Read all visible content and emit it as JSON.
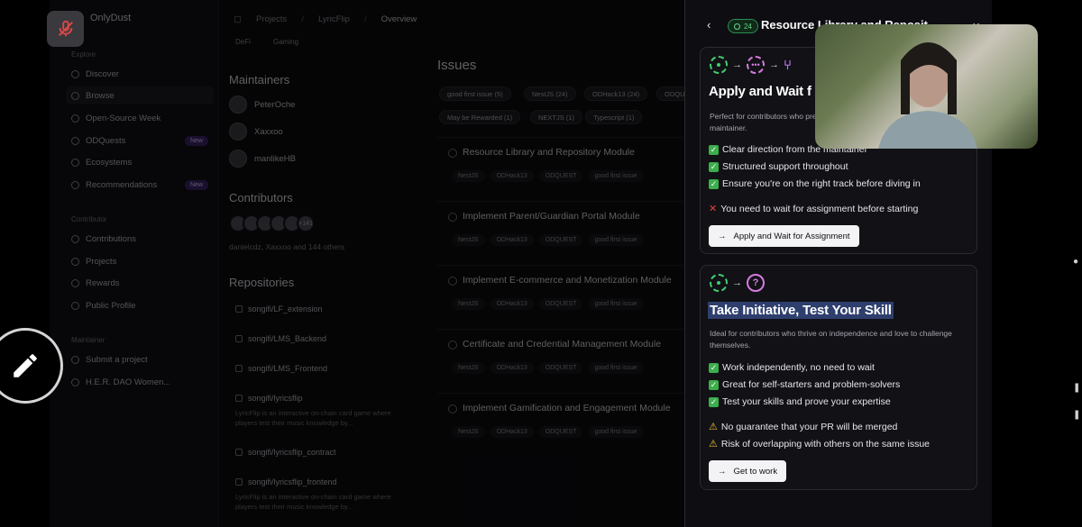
{
  "app": {
    "brand": "OnlyDust",
    "breadcrumbs": [
      "Projects",
      "LyricFlip",
      "Overview"
    ],
    "sidebar": {
      "explore_label": "Explore",
      "explore_items": [
        {
          "label": "Discover",
          "badge": ""
        },
        {
          "label": "Browse",
          "badge": ""
        },
        {
          "label": "Open-Source Week",
          "badge": ""
        },
        {
          "label": "ODQuests",
          "badge": "New"
        },
        {
          "label": "Ecosystems",
          "badge": ""
        },
        {
          "label": "Recommendations",
          "badge": "New"
        }
      ],
      "contributor_label": "Contributor",
      "contributor_items": [
        "Contributions",
        "Projects",
        "Rewards",
        "Public Profile"
      ],
      "maintainer_label": "Maintainer",
      "maintainer_items": [
        "Submit a project",
        "H.E.R. DAO Women..."
      ]
    },
    "categories": [
      "DeFi",
      "Gaming"
    ],
    "maintainers_title": "Maintainers",
    "maintainers": [
      "PeterOche",
      "Xaxxoo",
      "manlikeHB"
    ],
    "contributors_title": "Contributors",
    "contributors_more": "+141",
    "contributors_text": "danielcdz, Xaxxoo and 144 others",
    "repositories_title": "Repositories",
    "repositories": [
      {
        "name": "songifi/LF_extension",
        "desc": ""
      },
      {
        "name": "songifi/LMS_Backend",
        "desc": ""
      },
      {
        "name": "songifi/LMS_Frontend",
        "desc": ""
      },
      {
        "name": "songifi/lyricsflip",
        "desc": "LyricFlip is an interactive on-chain card game where players test their music knowledge by..."
      },
      {
        "name": "songifi/lyricsflip_contract",
        "desc": ""
      },
      {
        "name": "songifi/lyricsflip_frontend",
        "desc": "LyricFlip is an interactive on-chain card game where players test their music knowledge by..."
      }
    ],
    "issues_title": "Issues",
    "issue_filters": [
      "good first issue (5)",
      "NestJS (24)",
      "ODHack13 (24)",
      "ODQUE",
      "May be Rewarded (1)",
      "NEXTJS (1)",
      "Typescript (1)"
    ],
    "issues": [
      {
        "title": "Resource Library and Repository Module",
        "tags": [
          "NestJS",
          "ODHack13",
          "ODQUEST",
          "good first issue"
        ]
      },
      {
        "title": "Implement Parent/Guardian Portal Module",
        "tags": [
          "NestJS",
          "ODHack13",
          "ODQUEST",
          "good first issue"
        ]
      },
      {
        "title": "Implement E-commerce and Monetization Module",
        "tags": [
          "NestJS",
          "ODHack13",
          "ODQUEST",
          "good first issue"
        ]
      },
      {
        "title": "Certificate and Credential Management Module",
        "tags": [
          "NestJS",
          "ODHack13",
          "ODQUEST",
          "good first issue"
        ]
      },
      {
        "title": "Implement Gamification and Engagement Module",
        "tags": [
          "NestJS",
          "ODHack13",
          "ODQUEST",
          "good first issue"
        ]
      }
    ]
  },
  "drawer": {
    "count": "24",
    "title": "Resource Library and Reposit",
    "card1": {
      "title": "Apply and Wait f",
      "desc": "Perfect for contributors who prefer a clear path, with guidance from the maintainer.",
      "pros": [
        "Clear direction from the maintainer",
        "Structured support throughout",
        "Ensure you're on the right track before diving in"
      ],
      "cons": [
        "You need to wait for assignment before starting"
      ],
      "cta": "Apply and Wait for Assignment"
    },
    "card2": {
      "title": "Take Initiative, Test Your Skill",
      "desc": "Ideal for contributors who thrive on independence and love to challenge themselves.",
      "pros": [
        "Work independently, no need to wait",
        "Great for self-starters and problem-solvers",
        "Test your skills and prove your expertise"
      ],
      "warnings": [
        "No guarantee that your PR will be merged",
        "Risk of overlapping with others on the same issue"
      ],
      "cta": "Get to work"
    }
  },
  "colors": {
    "accent_green": "#3fcf6f",
    "accent_purple": "#d77be0",
    "highlight": "#2e3f6e",
    "drawer_bg": "#0e0e12"
  },
  "icons": {
    "mic": "mic-off-icon",
    "fab": "pencil-icon",
    "back": "chevron-left-icon",
    "close": "close-icon"
  }
}
